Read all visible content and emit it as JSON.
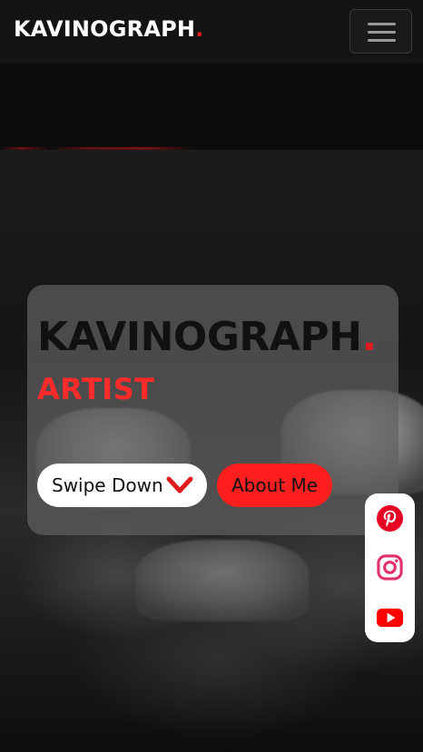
{
  "header": {
    "brand": "KAVINOGRAPH",
    "brand_dot": ".",
    "menu_icon": "hamburger-icon"
  },
  "hero": {
    "title": "KAVINOGRAPH",
    "title_dot": ".",
    "subtitle": "ARTIST",
    "swipe_label": "Swipe Down",
    "swipe_icon": "chevron-down-icon",
    "about_label": "About Me"
  },
  "social": {
    "items": [
      {
        "name": "pinterest",
        "icon": "pinterest-icon",
        "color": "#e60023"
      },
      {
        "name": "instagram",
        "icon": "instagram-icon",
        "color": "#e1306c"
      },
      {
        "name": "youtube",
        "icon": "youtube-icon",
        "color": "#ff0000"
      }
    ]
  },
  "colors": {
    "accent": "#e01b1b",
    "button_red": "#ff1f1f",
    "card_bg": "#5f5f5f",
    "nav_bg": "#141414"
  }
}
